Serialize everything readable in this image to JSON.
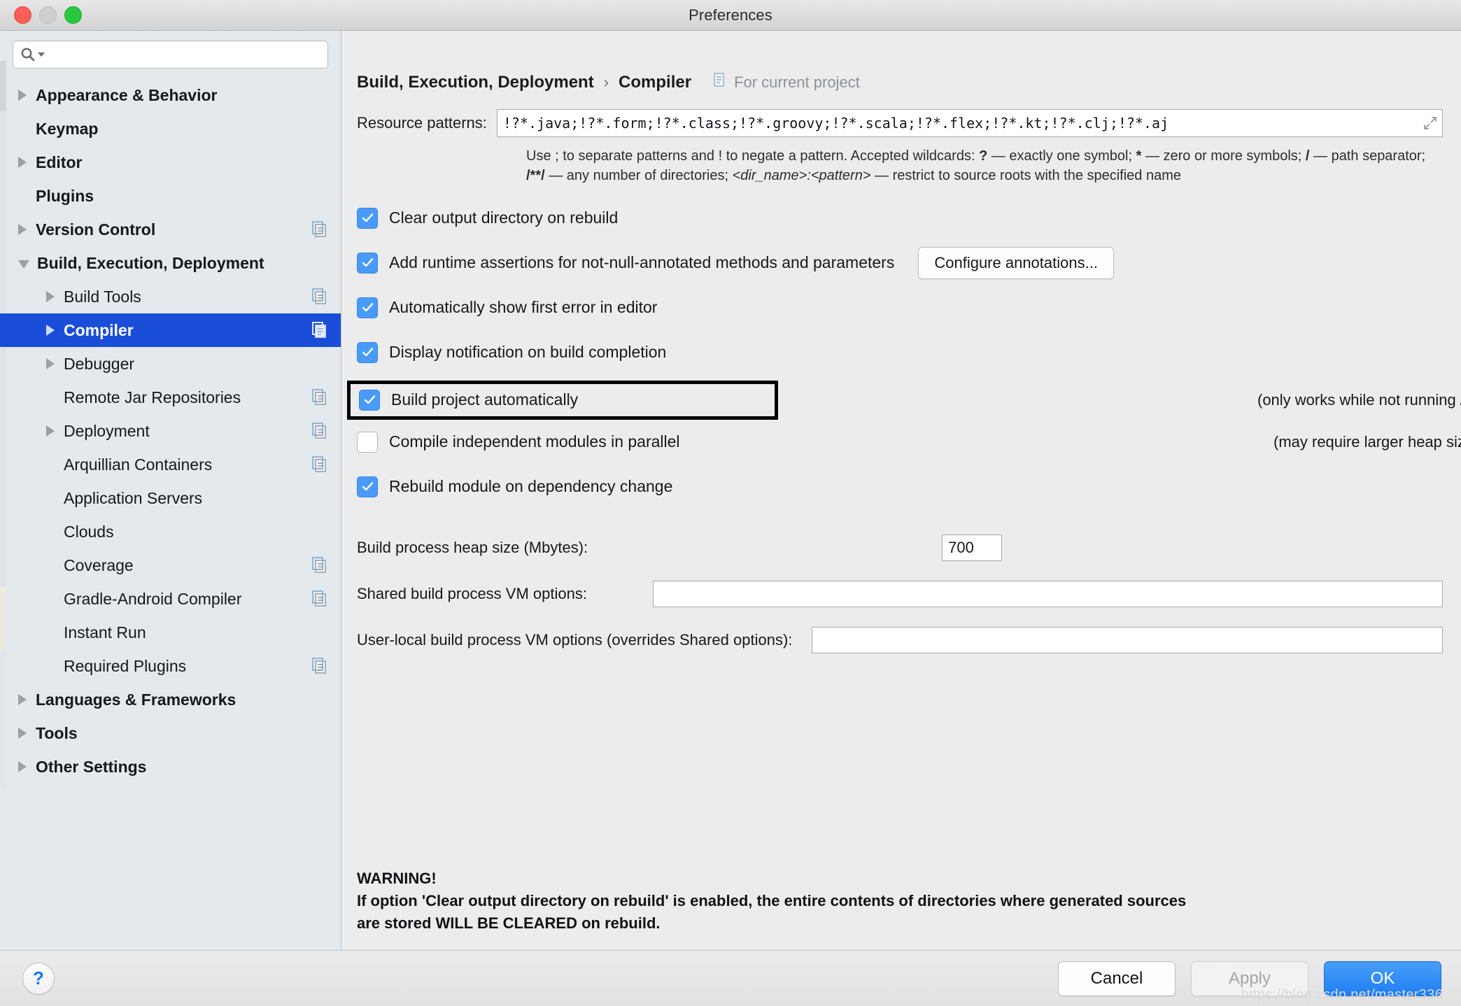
{
  "window": {
    "title": "Preferences",
    "traffic_lights": [
      "close",
      "minimize",
      "zoom"
    ]
  },
  "sidebar": {
    "search": {
      "value": "",
      "placeholder": ""
    },
    "items": [
      {
        "label": "Appearance & Behavior",
        "level": 0,
        "arrow": "right",
        "bold": true,
        "badge": false,
        "selected": false
      },
      {
        "label": "Keymap",
        "level": 0,
        "arrow": "none",
        "bold": true,
        "badge": false,
        "selected": false
      },
      {
        "label": "Editor",
        "level": 0,
        "arrow": "right",
        "bold": true,
        "badge": false,
        "selected": false
      },
      {
        "label": "Plugins",
        "level": 0,
        "arrow": "none",
        "bold": true,
        "badge": false,
        "selected": false
      },
      {
        "label": "Version Control",
        "level": 0,
        "arrow": "right",
        "bold": true,
        "badge": true,
        "selected": false
      },
      {
        "label": "Build, Execution, Deployment",
        "level": 0,
        "arrow": "down",
        "bold": true,
        "badge": false,
        "selected": false
      },
      {
        "label": "Build Tools",
        "level": 1,
        "arrow": "right",
        "bold": false,
        "badge": true,
        "selected": false
      },
      {
        "label": "Compiler",
        "level": 1,
        "arrow": "right",
        "bold": false,
        "badge": true,
        "selected": true
      },
      {
        "label": "Debugger",
        "level": 1,
        "arrow": "right",
        "bold": false,
        "badge": false,
        "selected": false
      },
      {
        "label": "Remote Jar Repositories",
        "level": 1,
        "arrow": "none",
        "bold": false,
        "badge": true,
        "selected": false
      },
      {
        "label": "Deployment",
        "level": 1,
        "arrow": "right",
        "bold": false,
        "badge": true,
        "selected": false
      },
      {
        "label": "Arquillian Containers",
        "level": 1,
        "arrow": "none",
        "bold": false,
        "badge": true,
        "selected": false
      },
      {
        "label": "Application Servers",
        "level": 1,
        "arrow": "none",
        "bold": false,
        "badge": false,
        "selected": false
      },
      {
        "label": "Clouds",
        "level": 1,
        "arrow": "none",
        "bold": false,
        "badge": false,
        "selected": false
      },
      {
        "label": "Coverage",
        "level": 1,
        "arrow": "none",
        "bold": false,
        "badge": true,
        "selected": false
      },
      {
        "label": "Gradle-Android Compiler",
        "level": 1,
        "arrow": "none",
        "bold": false,
        "badge": true,
        "selected": false
      },
      {
        "label": "Instant Run",
        "level": 1,
        "arrow": "none",
        "bold": false,
        "badge": false,
        "selected": false
      },
      {
        "label": "Required Plugins",
        "level": 1,
        "arrow": "none",
        "bold": false,
        "badge": true,
        "selected": false
      },
      {
        "label": "Languages & Frameworks",
        "level": 0,
        "arrow": "right",
        "bold": true,
        "badge": false,
        "selected": false
      },
      {
        "label": "Tools",
        "level": 0,
        "arrow": "right",
        "bold": true,
        "badge": false,
        "selected": false
      },
      {
        "label": "Other Settings",
        "level": 0,
        "arrow": "right",
        "bold": true,
        "badge": false,
        "selected": false
      }
    ]
  },
  "header": {
    "crumb_parent": "Build, Execution, Deployment",
    "crumb_separator": "›",
    "crumb_current": "Compiler",
    "project_scope": "For current project"
  },
  "patterns": {
    "label": "Resource patterns:",
    "value": "!?*.java;!?*.form;!?*.class;!?*.groovy;!?*.scala;!?*.flex;!?*.kt;!?*.clj;!?*.aj",
    "hint_1": "Use ; to separate patterns and ! to negate a pattern. Accepted wildcards: ",
    "hint_q": "?",
    "hint_2": " — exactly one symbol; ",
    "hint_star": "*",
    "hint_3": " — zero or more symbols; ",
    "hint_slash": "/",
    "hint_4": " — path separator; ",
    "hint_globstar": "/**/",
    "hint_5": " — any number of directories; ",
    "hint_dir": "<dir_name>:<pattern>",
    "hint_6": " — restrict to source roots with the specified name"
  },
  "options": [
    {
      "label": "Clear output directory on rebuild",
      "checked": true,
      "note": "",
      "button": "",
      "boxed": false
    },
    {
      "label": "Add runtime assertions for not-null-annotated methods and parameters",
      "checked": true,
      "note": "",
      "button": "Configure annotations...",
      "boxed": false
    },
    {
      "label": "Automatically show first error in editor",
      "checked": true,
      "note": "",
      "button": "",
      "boxed": false
    },
    {
      "label": "Display notification on build completion",
      "checked": true,
      "note": "",
      "button": "",
      "boxed": false
    },
    {
      "label": "Build project automatically",
      "checked": true,
      "note": "(only works while not running / debugging)",
      "button": "",
      "boxed": true
    },
    {
      "label": "Compile independent modules in parallel",
      "checked": false,
      "note": "(may require larger heap size)",
      "button": "",
      "boxed": false
    },
    {
      "label": "Rebuild module on dependency change",
      "checked": true,
      "note": "",
      "button": "",
      "boxed": false
    }
  ],
  "fields": {
    "heap_label": "Build process heap size (Mbytes):",
    "heap_value": "700",
    "shared_label": "Shared build process VM options:",
    "shared_value": "",
    "userlocal_label": "User-local build process VM options (overrides Shared options):",
    "userlocal_value": ""
  },
  "warning": {
    "title": "WARNING!",
    "line1": "If option 'Clear output directory on rebuild' is enabled, the entire contents of directories where generated sources",
    "line2": "are stored WILL BE CLEARED on rebuild."
  },
  "footer": {
    "help": "?",
    "cancel": "Cancel",
    "apply": "Apply",
    "ok": "OK",
    "watermark": "https://blog.csdn.net/master336"
  },
  "colors": {
    "selection_blue": "#1b4ed8",
    "checkbox_blue": "#4a9bf7",
    "primary_button_blue": "#1d7df2",
    "sidebar_bg": "#e4e9ed",
    "panel_bg": "#ececec"
  }
}
